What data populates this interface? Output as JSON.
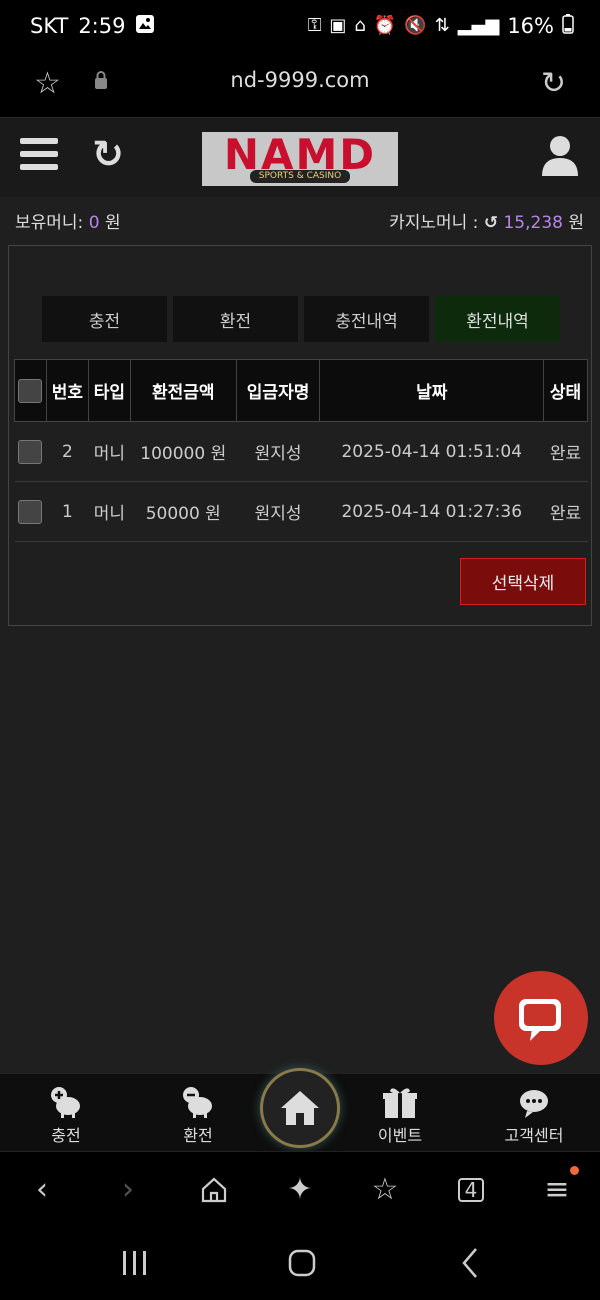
{
  "status_bar": {
    "carrier": "SKT",
    "time": "2:59",
    "battery": "16%"
  },
  "browser": {
    "url": "nd-9999.com",
    "tab_count": "4"
  },
  "site": {
    "logo_text": "NAMD",
    "logo_sub": "SPORTS & CASINO"
  },
  "balance": {
    "money_label": "보유머니:",
    "money_value": "0",
    "money_unit": "원",
    "casino_label": "카지노머니 :",
    "casino_value": "15,238",
    "casino_unit": "원"
  },
  "tabs": [
    {
      "label": "충전",
      "active": false
    },
    {
      "label": "환전",
      "active": false
    },
    {
      "label": "충전내역",
      "active": false
    },
    {
      "label": "환전내역",
      "active": true
    }
  ],
  "table": {
    "headers": [
      "번호",
      "타입",
      "환전금액",
      "입금자명",
      "날짜",
      "상태"
    ],
    "rows": [
      {
        "no": "2",
        "type": "머니",
        "amount": "100000 원",
        "name": "원지성",
        "date": "2025-04-14 01:51:04",
        "status": "완료"
      },
      {
        "no": "1",
        "type": "머니",
        "amount": "50000 원",
        "name": "원지성",
        "date": "2025-04-14 01:27:36",
        "status": "완료"
      }
    ]
  },
  "delete_button": "선택삭제",
  "bottom_nav": [
    {
      "label": "충전"
    },
    {
      "label": "환전"
    },
    {
      "label": "이벤트"
    },
    {
      "label": "고객센터"
    }
  ],
  "colors": {
    "accent_purple": "#b785e8",
    "delete_red": "#7a0c0c",
    "active_tab": "#0d2a0d",
    "chat_red": "#c8342a"
  }
}
